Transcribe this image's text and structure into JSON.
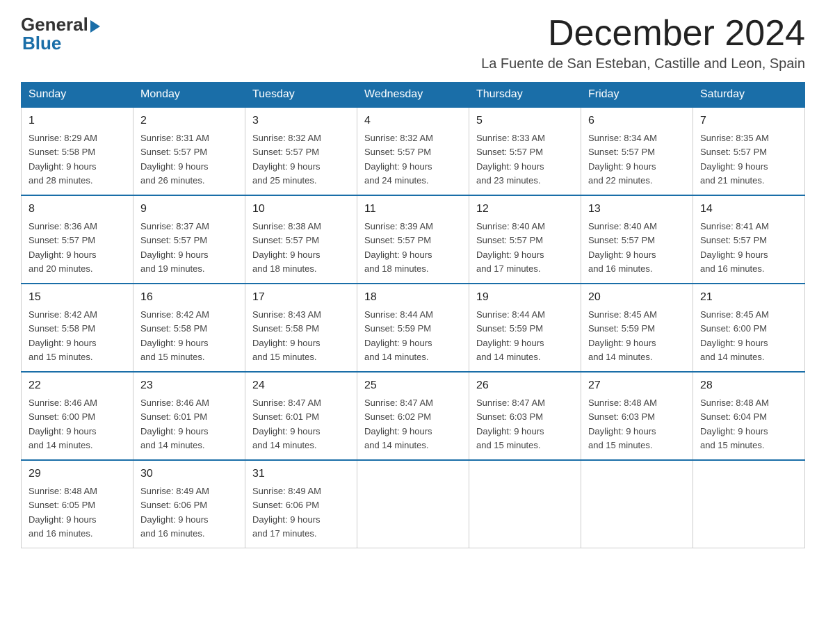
{
  "logo": {
    "general": "General",
    "blue": "Blue"
  },
  "title": "December 2024",
  "subtitle": "La Fuente de San Esteban, Castille and Leon, Spain",
  "weekdays": [
    "Sunday",
    "Monday",
    "Tuesday",
    "Wednesday",
    "Thursday",
    "Friday",
    "Saturday"
  ],
  "weeks": [
    [
      {
        "day": "1",
        "sunrise": "8:29 AM",
        "sunset": "5:58 PM",
        "daylight": "9 hours and 28 minutes."
      },
      {
        "day": "2",
        "sunrise": "8:31 AM",
        "sunset": "5:57 PM",
        "daylight": "9 hours and 26 minutes."
      },
      {
        "day": "3",
        "sunrise": "8:32 AM",
        "sunset": "5:57 PM",
        "daylight": "9 hours and 25 minutes."
      },
      {
        "day": "4",
        "sunrise": "8:32 AM",
        "sunset": "5:57 PM",
        "daylight": "9 hours and 24 minutes."
      },
      {
        "day": "5",
        "sunrise": "8:33 AM",
        "sunset": "5:57 PM",
        "daylight": "9 hours and 23 minutes."
      },
      {
        "day": "6",
        "sunrise": "8:34 AM",
        "sunset": "5:57 PM",
        "daylight": "9 hours and 22 minutes."
      },
      {
        "day": "7",
        "sunrise": "8:35 AM",
        "sunset": "5:57 PM",
        "daylight": "9 hours and 21 minutes."
      }
    ],
    [
      {
        "day": "8",
        "sunrise": "8:36 AM",
        "sunset": "5:57 PM",
        "daylight": "9 hours and 20 minutes."
      },
      {
        "day": "9",
        "sunrise": "8:37 AM",
        "sunset": "5:57 PM",
        "daylight": "9 hours and 19 minutes."
      },
      {
        "day": "10",
        "sunrise": "8:38 AM",
        "sunset": "5:57 PM",
        "daylight": "9 hours and 18 minutes."
      },
      {
        "day": "11",
        "sunrise": "8:39 AM",
        "sunset": "5:57 PM",
        "daylight": "9 hours and 18 minutes."
      },
      {
        "day": "12",
        "sunrise": "8:40 AM",
        "sunset": "5:57 PM",
        "daylight": "9 hours and 17 minutes."
      },
      {
        "day": "13",
        "sunrise": "8:40 AM",
        "sunset": "5:57 PM",
        "daylight": "9 hours and 16 minutes."
      },
      {
        "day": "14",
        "sunrise": "8:41 AM",
        "sunset": "5:57 PM",
        "daylight": "9 hours and 16 minutes."
      }
    ],
    [
      {
        "day": "15",
        "sunrise": "8:42 AM",
        "sunset": "5:58 PM",
        "daylight": "9 hours and 15 minutes."
      },
      {
        "day": "16",
        "sunrise": "8:42 AM",
        "sunset": "5:58 PM",
        "daylight": "9 hours and 15 minutes."
      },
      {
        "day": "17",
        "sunrise": "8:43 AM",
        "sunset": "5:58 PM",
        "daylight": "9 hours and 15 minutes."
      },
      {
        "day": "18",
        "sunrise": "8:44 AM",
        "sunset": "5:59 PM",
        "daylight": "9 hours and 14 minutes."
      },
      {
        "day": "19",
        "sunrise": "8:44 AM",
        "sunset": "5:59 PM",
        "daylight": "9 hours and 14 minutes."
      },
      {
        "day": "20",
        "sunrise": "8:45 AM",
        "sunset": "5:59 PM",
        "daylight": "9 hours and 14 minutes."
      },
      {
        "day": "21",
        "sunrise": "8:45 AM",
        "sunset": "6:00 PM",
        "daylight": "9 hours and 14 minutes."
      }
    ],
    [
      {
        "day": "22",
        "sunrise": "8:46 AM",
        "sunset": "6:00 PM",
        "daylight": "9 hours and 14 minutes."
      },
      {
        "day": "23",
        "sunrise": "8:46 AM",
        "sunset": "6:01 PM",
        "daylight": "9 hours and 14 minutes."
      },
      {
        "day": "24",
        "sunrise": "8:47 AM",
        "sunset": "6:01 PM",
        "daylight": "9 hours and 14 minutes."
      },
      {
        "day": "25",
        "sunrise": "8:47 AM",
        "sunset": "6:02 PM",
        "daylight": "9 hours and 14 minutes."
      },
      {
        "day": "26",
        "sunrise": "8:47 AM",
        "sunset": "6:03 PM",
        "daylight": "9 hours and 15 minutes."
      },
      {
        "day": "27",
        "sunrise": "8:48 AM",
        "sunset": "6:03 PM",
        "daylight": "9 hours and 15 minutes."
      },
      {
        "day": "28",
        "sunrise": "8:48 AM",
        "sunset": "6:04 PM",
        "daylight": "9 hours and 15 minutes."
      }
    ],
    [
      {
        "day": "29",
        "sunrise": "8:48 AM",
        "sunset": "6:05 PM",
        "daylight": "9 hours and 16 minutes."
      },
      {
        "day": "30",
        "sunrise": "8:49 AM",
        "sunset": "6:06 PM",
        "daylight": "9 hours and 16 minutes."
      },
      {
        "day": "31",
        "sunrise": "8:49 AM",
        "sunset": "6:06 PM",
        "daylight": "9 hours and 17 minutes."
      },
      null,
      null,
      null,
      null
    ]
  ],
  "labels": {
    "sunrise": "Sunrise:",
    "sunset": "Sunset:",
    "daylight": "Daylight:"
  }
}
